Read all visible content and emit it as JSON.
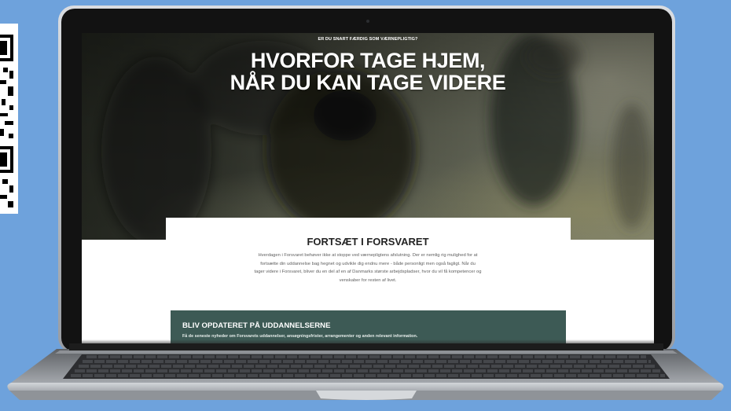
{
  "hero": {
    "kicker": "ER DU SNART FÆRDIG SOM VÆRNEPLIGTIG?",
    "title": [
      "HVORFOR TAGE HJEM,",
      "NÅR DU KAN TAGE VIDERE"
    ]
  },
  "intro": {
    "heading": "FORTSÆT I FORSVARET",
    "body_lines": [
      "Hverdagen i Forsvaret behøver ikke at stoppe ved værnepligtens afslutning. Der er nemlig rig mulighed for at",
      "fortsætte din uddannelse bag hegnet og udvikle dig endnu mere - både personligt men også fagligt. Når du",
      "tager videre i Forsvaret, bliver du en del af en af Danmarks største arbejdspladser, hvor du vil få kompetencer og",
      "venskaber for resten af livet."
    ]
  },
  "newsletter": {
    "heading": "BLIV OPDATERET PÅ UDDANNELSERNE",
    "text": "Få de seneste nyheder om Forsvarets uddannelser, ansøgningsfrister, arrangementer og anden relevant information."
  },
  "colors": {
    "background": "#6ea2dc",
    "newsletter_bg": "#3d5a55",
    "hero_text": "#ffffff",
    "heading_text": "#232323",
    "body_text": "#616161"
  }
}
